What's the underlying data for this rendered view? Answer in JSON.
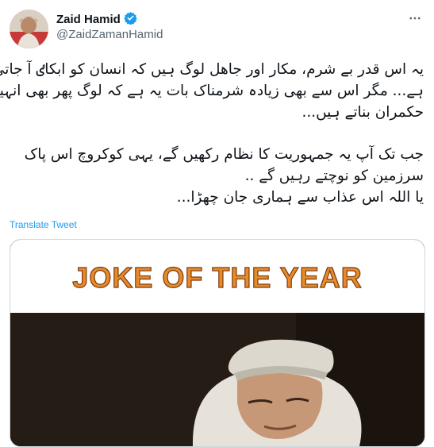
{
  "author": {
    "name": "Zaid Hamid",
    "handle": "@ZaidZamanHamid",
    "verified_icon": "verified-badge-icon"
  },
  "menu_icon": "more-options-icon",
  "tweet_lines": [
    "یہ اس قدر بے شرم، مکار اور جاھل لوگ ہیں کہ انسان کو ابکاٸ آ جاتی",
    "ہے... مگر اس سے بھی زیادہ شرمناک بات یہ ہے کہ لوگ پھر بھی انہیں",
    "حکمران بناتے ہیں...",
    "جب تک آپ یہ جمہوریت کا نظام رکھیں گے، یہی کوکروچ اس پاک",
    "سرزمین کو نوچتے رہیں گے ..",
    "یا اللہ اس عذاب سے ہماری جان چھڑا..."
  ],
  "translate_label": "Translate Tweet",
  "media": {
    "caption": "JOKE OF THE YEAR",
    "caption_color": "#e88a2a"
  }
}
